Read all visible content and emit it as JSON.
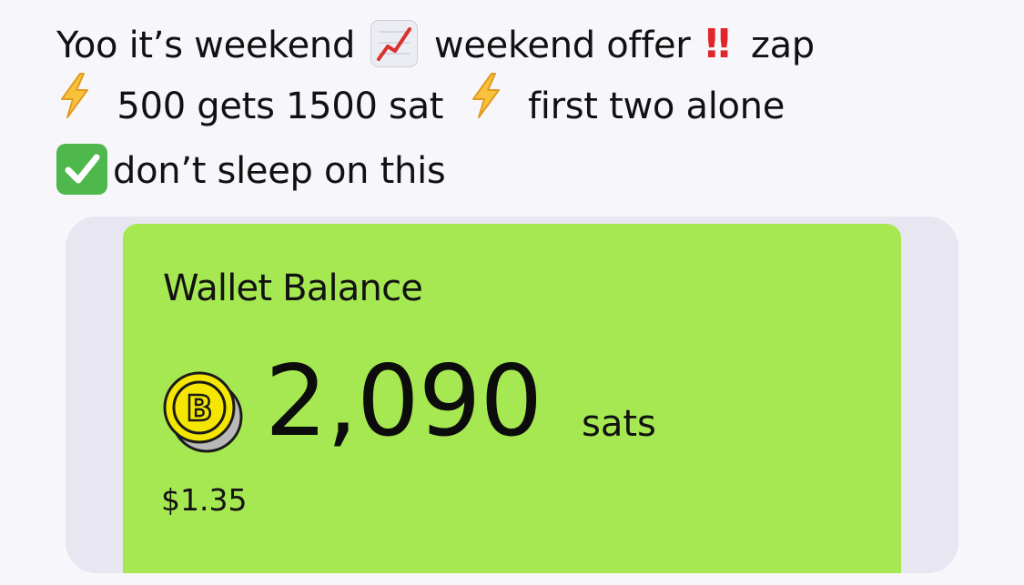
{
  "post": {
    "line1_part1": "Yoo it’s weekend",
    "line1_part2": "weekend offer",
    "line1_part3": "zap",
    "line2_part1": "500 gets 1500 sat",
    "line2_part2": "first two alone",
    "line3_part1": "don’t sleep on this",
    "bang_glyph": "‼",
    "icons": [
      "chart-increasing-emoji",
      "double-exclamation-emoji",
      "high-voltage-emoji",
      "check-mark-button-emoji"
    ]
  },
  "wallet": {
    "title": "Wallet Balance",
    "amount": "2,090",
    "unit": "sats",
    "fiat": "$1.35",
    "coin_symbol": "B",
    "colors": {
      "card": "#a6e852",
      "frame": "#e7e6f1",
      "coin": "#f4e600"
    }
  }
}
